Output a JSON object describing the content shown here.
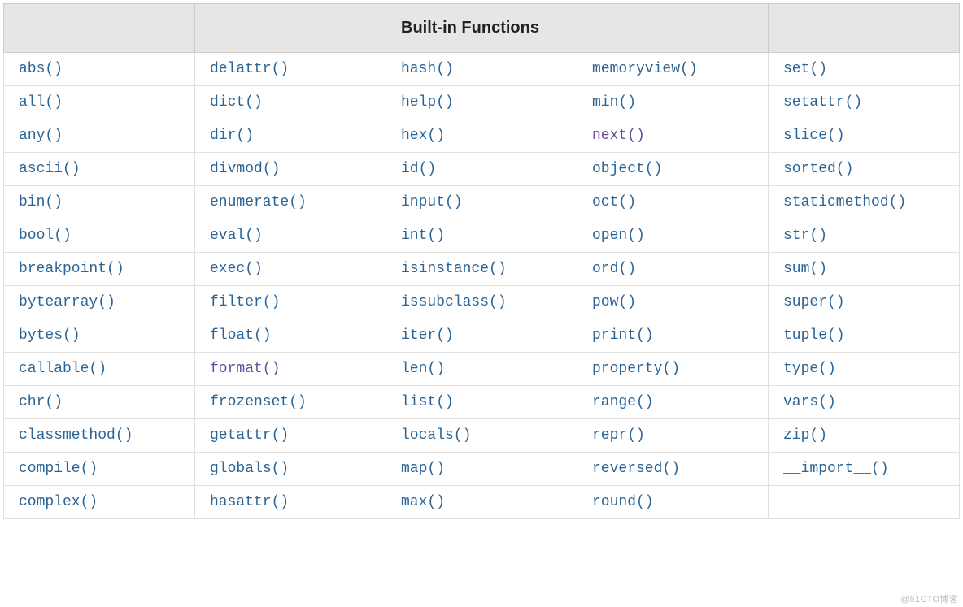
{
  "header": {
    "col1": "",
    "col2": "",
    "col3": "Built-in Functions",
    "col4": "",
    "col5": ""
  },
  "rows": [
    {
      "c1": {
        "label": "abs()",
        "visited": false
      },
      "c2": {
        "label": "delattr()",
        "visited": false
      },
      "c3": {
        "label": "hash()",
        "visited": false
      },
      "c4": {
        "label": "memoryview()",
        "visited": false
      },
      "c5": {
        "label": "set()",
        "visited": false
      }
    },
    {
      "c1": {
        "label": "all()",
        "visited": false
      },
      "c2": {
        "label": "dict()",
        "visited": false
      },
      "c3": {
        "label": "help()",
        "visited": false
      },
      "c4": {
        "label": "min()",
        "visited": false
      },
      "c5": {
        "label": "setattr()",
        "visited": false
      }
    },
    {
      "c1": {
        "label": "any()",
        "visited": false
      },
      "c2": {
        "label": "dir()",
        "visited": false
      },
      "c3": {
        "label": "hex()",
        "visited": false
      },
      "c4": {
        "label": "next()",
        "visited": true
      },
      "c5": {
        "label": "slice()",
        "visited": false
      }
    },
    {
      "c1": {
        "label": "ascii()",
        "visited": false
      },
      "c2": {
        "label": "divmod()",
        "visited": false
      },
      "c3": {
        "label": "id()",
        "visited": false
      },
      "c4": {
        "label": "object()",
        "visited": false
      },
      "c5": {
        "label": "sorted()",
        "visited": false
      }
    },
    {
      "c1": {
        "label": "bin()",
        "visited": false
      },
      "c2": {
        "label": "enumerate()",
        "visited": false
      },
      "c3": {
        "label": "input()",
        "visited": false
      },
      "c4": {
        "label": "oct()",
        "visited": false
      },
      "c5": {
        "label": "staticmethod()",
        "visited": false
      }
    },
    {
      "c1": {
        "label": "bool()",
        "visited": false
      },
      "c2": {
        "label": "eval()",
        "visited": false
      },
      "c3": {
        "label": "int()",
        "visited": false
      },
      "c4": {
        "label": "open()",
        "visited": false
      },
      "c5": {
        "label": "str()",
        "visited": false
      }
    },
    {
      "c1": {
        "label": "breakpoint()",
        "visited": false
      },
      "c2": {
        "label": "exec()",
        "visited": false
      },
      "c3": {
        "label": "isinstance()",
        "visited": false
      },
      "c4": {
        "label": "ord()",
        "visited": false
      },
      "c5": {
        "label": "sum()",
        "visited": false
      }
    },
    {
      "c1": {
        "label": "bytearray()",
        "visited": false
      },
      "c2": {
        "label": "filter()",
        "visited": false
      },
      "c3": {
        "label": "issubclass()",
        "visited": false
      },
      "c4": {
        "label": "pow()",
        "visited": false
      },
      "c5": {
        "label": "super()",
        "visited": false
      }
    },
    {
      "c1": {
        "label": "bytes()",
        "visited": false
      },
      "c2": {
        "label": "float()",
        "visited": false
      },
      "c3": {
        "label": "iter()",
        "visited": false
      },
      "c4": {
        "label": "print()",
        "visited": false
      },
      "c5": {
        "label": "tuple()",
        "visited": false
      }
    },
    {
      "c1": {
        "label": "callable()",
        "visited": false
      },
      "c2": {
        "label": "format()",
        "visited": true
      },
      "c3": {
        "label": "len()",
        "visited": false
      },
      "c4": {
        "label": "property()",
        "visited": false
      },
      "c5": {
        "label": "type()",
        "visited": false
      }
    },
    {
      "c1": {
        "label": "chr()",
        "visited": false
      },
      "c2": {
        "label": "frozenset()",
        "visited": false
      },
      "c3": {
        "label": "list()",
        "visited": false
      },
      "c4": {
        "label": "range()",
        "visited": false
      },
      "c5": {
        "label": "vars()",
        "visited": false
      }
    },
    {
      "c1": {
        "label": "classmethod()",
        "visited": false
      },
      "c2": {
        "label": "getattr()",
        "visited": false
      },
      "c3": {
        "label": "locals()",
        "visited": false
      },
      "c4": {
        "label": "repr()",
        "visited": false
      },
      "c5": {
        "label": "zip()",
        "visited": false
      }
    },
    {
      "c1": {
        "label": "compile()",
        "visited": false
      },
      "c2": {
        "label": "globals()",
        "visited": false
      },
      "c3": {
        "label": "map()",
        "visited": false
      },
      "c4": {
        "label": "reversed()",
        "visited": false
      },
      "c5": {
        "label": "__import__()",
        "visited": false
      }
    },
    {
      "c1": {
        "label": "complex()",
        "visited": false
      },
      "c2": {
        "label": "hasattr()",
        "visited": false
      },
      "c3": {
        "label": "max()",
        "visited": false
      },
      "c4": {
        "label": "round()",
        "visited": false
      },
      "c5": {
        "label": "",
        "visited": false
      }
    }
  ],
  "watermark": "@51CTO博客"
}
